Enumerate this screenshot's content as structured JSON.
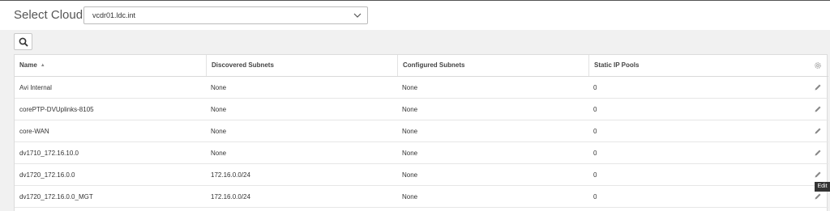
{
  "header": {
    "select_label": "Select Cloud:",
    "cloud_value": "vcdr01.ldc.int"
  },
  "table": {
    "columns": [
      "Name",
      "Discovered Subnets",
      "Configured Subnets",
      "Static IP Pools"
    ],
    "sort_indicator": "▲",
    "rows": [
      {
        "name": "Avi Internal",
        "discovered": "None",
        "configured": "None",
        "pools": "0"
      },
      {
        "name": "corePTP-DVUplinks-8105",
        "discovered": "None",
        "configured": "None",
        "pools": "0"
      },
      {
        "name": "core-WAN",
        "discovered": "None",
        "configured": "None",
        "pools": "0"
      },
      {
        "name": "dv1710_172.16.10.0",
        "discovered": "None",
        "configured": "None",
        "pools": "0"
      },
      {
        "name": "dv1720_172.16.0.0",
        "discovered": "172.16.0.0/24",
        "configured": "None",
        "pools": "0"
      },
      {
        "name": "dv1720_172.16.0.0_MGT",
        "discovered": "172.16.0.0/24",
        "configured": "None",
        "pools": "0"
      }
    ]
  },
  "tooltip": "Edit",
  "icons": {
    "search": "search-icon",
    "settings": "gear-icon",
    "edit": "pencil-icon",
    "dropdown": "chevron-down-icon"
  }
}
